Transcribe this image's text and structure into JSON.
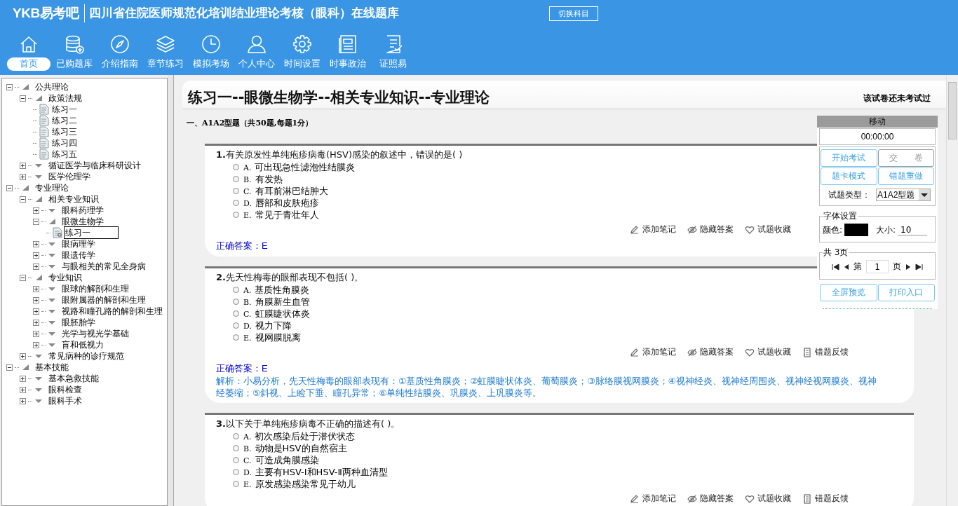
{
  "header": {
    "logo": "YKB易考吧",
    "title": "四川省住院医师规范化培训结业理论考核（眼科）在线题库",
    "switch_button": "切换科目"
  },
  "nav": [
    {
      "label": "首页",
      "selected": true
    },
    {
      "label": "已购题库",
      "selected": false
    },
    {
      "label": "介绍指南",
      "selected": false
    },
    {
      "label": "章节练习",
      "selected": false
    },
    {
      "label": "模拟考场",
      "selected": false
    },
    {
      "label": "个人中心",
      "selected": false
    },
    {
      "label": "时间设置",
      "selected": false
    },
    {
      "label": "时事政治",
      "selected": false
    },
    {
      "label": "证照易",
      "selected": false
    }
  ],
  "tree": [
    {
      "label": "公共理论",
      "expanded": true,
      "children": [
        {
          "label": "政策法规",
          "expanded": true,
          "children": [
            {
              "label": "练习一",
              "selected": false
            },
            {
              "label": "练习二",
              "selected": false
            },
            {
              "label": "练习三",
              "selected": false
            },
            {
              "label": "练习四",
              "selected": false
            },
            {
              "label": "练习五",
              "selected": false
            }
          ]
        },
        {
          "label": "循证医学与临床科研设计",
          "expanded": false
        },
        {
          "label": "医学伦理学",
          "expanded": false
        }
      ]
    },
    {
      "label": "专业理论",
      "expanded": true,
      "children": [
        {
          "label": "相关专业知识",
          "expanded": true,
          "children": [
            {
              "label": "眼科药理学",
              "expanded": false
            },
            {
              "label": "眼微生物学",
              "expanded": true,
              "children": [
                {
                  "label": "练习一",
                  "selected": true
                }
              ]
            },
            {
              "label": "眼病理学",
              "expanded": false
            },
            {
              "label": "眼遗传学",
              "expanded": false
            },
            {
              "label": "与眼相关的常见全身病",
              "expanded": false
            }
          ]
        },
        {
          "label": "专业知识",
          "expanded": true,
          "children": [
            {
              "label": "眼球的解剖和生理",
              "expanded": false
            },
            {
              "label": "眼附属器的解剖和生理",
              "expanded": false
            },
            {
              "label": "视路和瞳孔路的解剖和生理",
              "expanded": false
            },
            {
              "label": "眼胚胎学",
              "expanded": false
            },
            {
              "label": "光学与视光学基础",
              "expanded": false
            },
            {
              "label": "盲和低视力",
              "expanded": false
            }
          ]
        },
        {
          "label": "常见病种的诊疗规范",
          "expanded": false
        }
      ]
    },
    {
      "label": "基本技能",
      "expanded": true,
      "children": [
        {
          "label": "基本急救技能",
          "expanded": false
        },
        {
          "label": "眼科检查",
          "expanded": false
        },
        {
          "label": "眼科手术",
          "expanded": false
        }
      ]
    }
  ],
  "exam": {
    "title": "练习一--眼微生物学--相关专业知识--专业理论",
    "status": "该试卷还未考试过",
    "section": "一、A1A2型题（共50题,每题1分）",
    "questions": [
      {
        "number": "1.",
        "text": "有关原发性单纯疱疹病毒(HSV)感染的叙述中，错误的是( )",
        "options": [
          {
            "letter": "A.",
            "text": "可出现急性滤泡性结膜炎",
            "selected": false
          },
          {
            "letter": "B.",
            "text": "有发热",
            "selected": false
          },
          {
            "letter": "C.",
            "text": "有耳前淋巴结肿大",
            "selected": false
          },
          {
            "letter": "D.",
            "text": "唇部和皮肤疱疹",
            "selected": false
          },
          {
            "letter": "E.",
            "text": "常见于青壮年人",
            "selected": false
          }
        ],
        "actions": [
          "添加笔记",
          "隐藏答案",
          "试题收藏"
        ],
        "answer_label": "正确答案：",
        "answer": "E"
      },
      {
        "number": "2.",
        "text": "先天性梅毒的眼部表现不包括( )。",
        "options": [
          {
            "letter": "A.",
            "text": "基质性角膜炎",
            "selected": false
          },
          {
            "letter": "B.",
            "text": "角膜新生血管",
            "selected": false
          },
          {
            "letter": "C.",
            "text": "虹膜睫状体炎",
            "selected": false
          },
          {
            "letter": "D.",
            "text": "视力下降",
            "selected": false
          },
          {
            "letter": "E.",
            "text": "视网膜脱离",
            "selected": false
          }
        ],
        "actions": [
          "添加笔记",
          "隐藏答案",
          "试题收藏",
          "错题反馈"
        ],
        "answer_label": "正确答案：",
        "answer": "E",
        "explanation": "解析：小易分析，先天性梅毒的眼部表现有：①基质性角膜炎；②虹膜睫状体炎、葡萄膜炎；③脉络膜视网膜炎；④视神经炎、视神经周围炎、视神经视网膜炎、视神经萎缩；⑤斜视、上睑下垂、瞳孔异常；⑥单纯性结膜炎、巩膜炎、上巩膜炎等。"
      },
      {
        "number": "3.",
        "text": "以下关于单纯疱疹病毒不正确的描述有( )。",
        "options": [
          {
            "letter": "A.",
            "text": "初次感染后处于潜伏状态",
            "selected": false
          },
          {
            "letter": "B.",
            "text": "动物是HSV的自然宿主",
            "selected": false
          },
          {
            "letter": "C.",
            "text": "可造成角膜感染",
            "selected": false
          },
          {
            "letter": "D.",
            "text": "主要有HSV-Ⅰ和HSV-Ⅱ两种血清型",
            "selected": false
          },
          {
            "letter": "E.",
            "text": "原发感染感染常见于幼儿",
            "selected": false
          }
        ],
        "actions": [
          "添加笔记",
          "隐藏答案",
          "试题收藏",
          "错题反馈"
        ]
      }
    ]
  },
  "panel": {
    "header": "移动",
    "timer": "00:00:00",
    "buttons": [
      {
        "label": "开始考试",
        "disabled": false
      },
      {
        "label": "交　　卷",
        "disabled": true
      },
      {
        "label": "题卡模式",
        "disabled": false
      },
      {
        "label": "错题重做",
        "disabled": false
      }
    ],
    "type_label": "试题类型：",
    "type_value": "A1A2型题",
    "font_legend": "字体设置",
    "color_label": "颜色:",
    "font_swatch": {
      "color": "#000000"
    },
    "size_label": "大小:",
    "size_value": "10",
    "page_legend": "共 3页",
    "page_prefix": "第",
    "page_value": "1",
    "page_suffix": "页",
    "bottom_buttons": [
      {
        "label": "全屏预览",
        "disabled": false
      },
      {
        "label": "打印入口",
        "disabled": false
      }
    ]
  }
}
